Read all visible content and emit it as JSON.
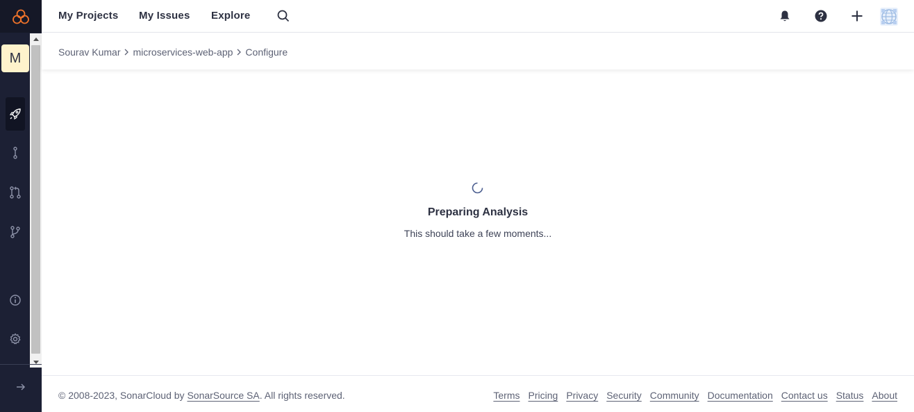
{
  "nav": {
    "links": [
      "My Projects",
      "My Issues",
      "Explore"
    ],
    "icons": [
      "search-icon",
      "bell-icon",
      "help-icon",
      "plus-icon",
      "user-avatar"
    ]
  },
  "sidebar": {
    "project_initial": "M",
    "items": [
      "rocket-icon",
      "commit-icon",
      "pull-request-icon",
      "branch-icon",
      "info-icon",
      "gear-icon"
    ],
    "collapse_icon": "arrow-right-icon"
  },
  "breadcrumb": {
    "items": [
      "Sourav Kumar",
      "microservices-web-app",
      "Configure"
    ]
  },
  "main": {
    "title": "Preparing Analysis",
    "subtitle": "This should take a few moments..."
  },
  "footer": {
    "copyright_prefix": "© 2008-2023, SonarCloud by ",
    "company": "SonarSource SA",
    "copyright_suffix": ". All rights reserved.",
    "links": [
      "Terms",
      "Pricing",
      "Privacy",
      "Security",
      "Community",
      "Documentation",
      "Contact us",
      "Status",
      "About"
    ]
  },
  "colors": {
    "sidebar": "#1c2034",
    "logo_accent": "#f0732a",
    "project_avatar_bg": "#fff3cc"
  }
}
